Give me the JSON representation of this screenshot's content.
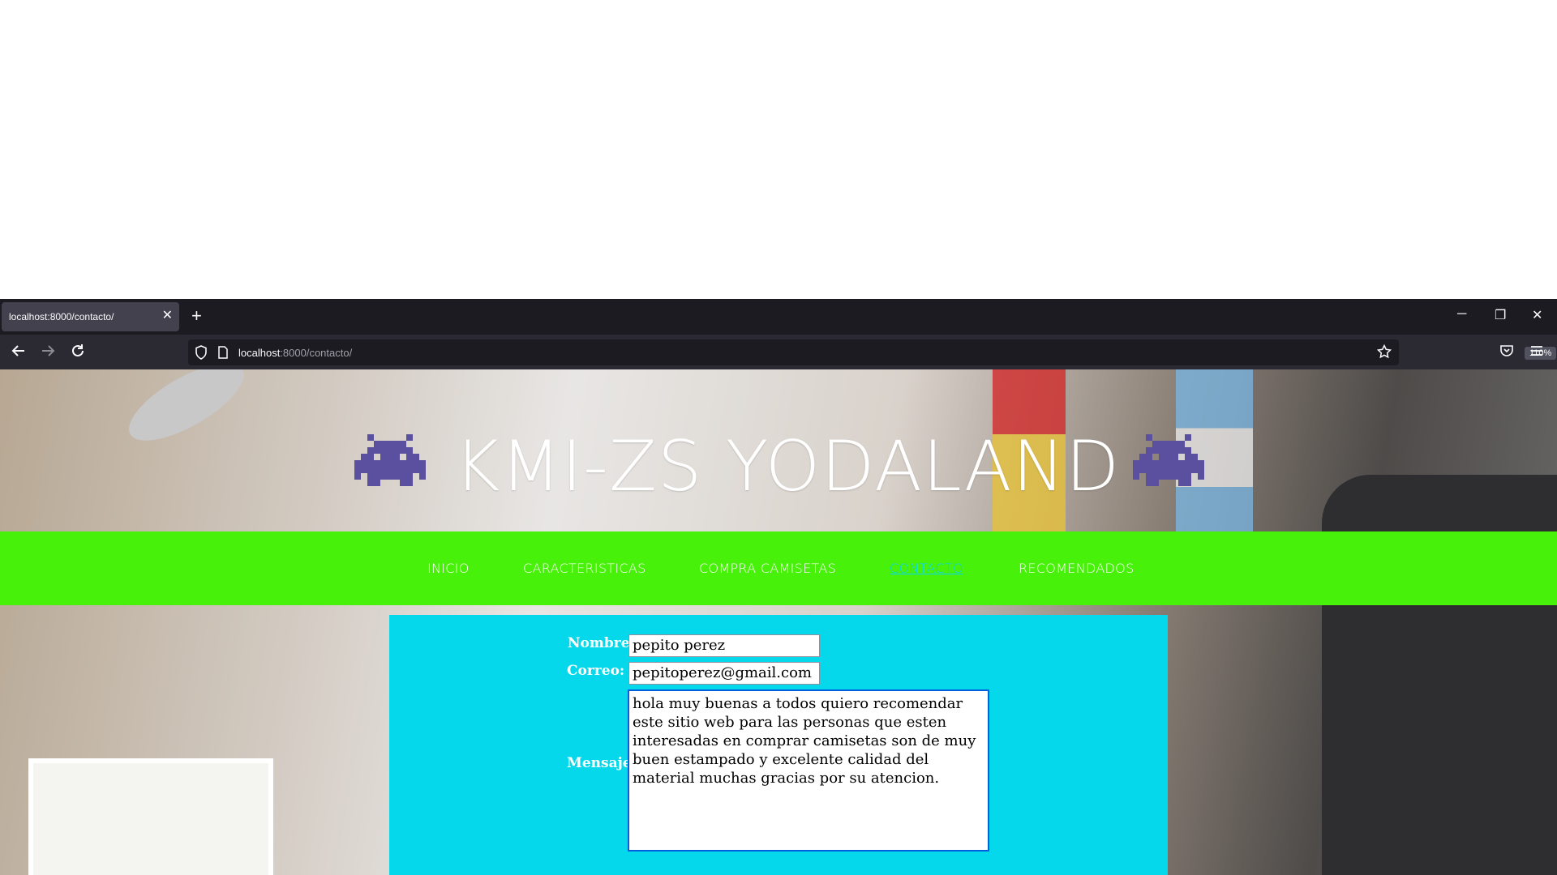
{
  "browser": {
    "tab_title": "localhost:8000/contacto/",
    "tab_close": "✕",
    "new_tab": "+",
    "url_host": "localhost",
    "url_path": ":8000/contacto/",
    "zoom": "110%",
    "window_controls": {
      "minimize": "─",
      "restore": "❐",
      "close": "✕"
    }
  },
  "page": {
    "site_title": "KMI-ZS YODALAND",
    "icons": {
      "left": "space-invader-icon",
      "right": "space-invader-icon"
    },
    "menu": [
      {
        "label": "INICIO",
        "active": false
      },
      {
        "label": "CARACTERISTICAS",
        "active": false
      },
      {
        "label": "COMPRA CAMISETAS",
        "active": false
      },
      {
        "label": "CONTACTO",
        "active": true
      },
      {
        "label": "RECOMENDADOS",
        "active": false
      }
    ],
    "form": {
      "nombre_label": "Nombre:",
      "nombre_value": "pepito perez",
      "correo_label": "Correo:",
      "correo_value": "pepitoperez@gmail.com",
      "mensaje_label": "Mensaje:",
      "mensaje_value": "hola muy buenas a todos quiero recomendar este sitio web para las personas que esten interesadas en comprar camisetas son de muy buen estampado y excelente calidad del material muchas gracias por su atencion."
    },
    "colors": {
      "menu_bg": "#48f109",
      "form_bg": "#05d8ea",
      "active_link": "#00d4ff",
      "invader": "#5b4fa0"
    }
  }
}
